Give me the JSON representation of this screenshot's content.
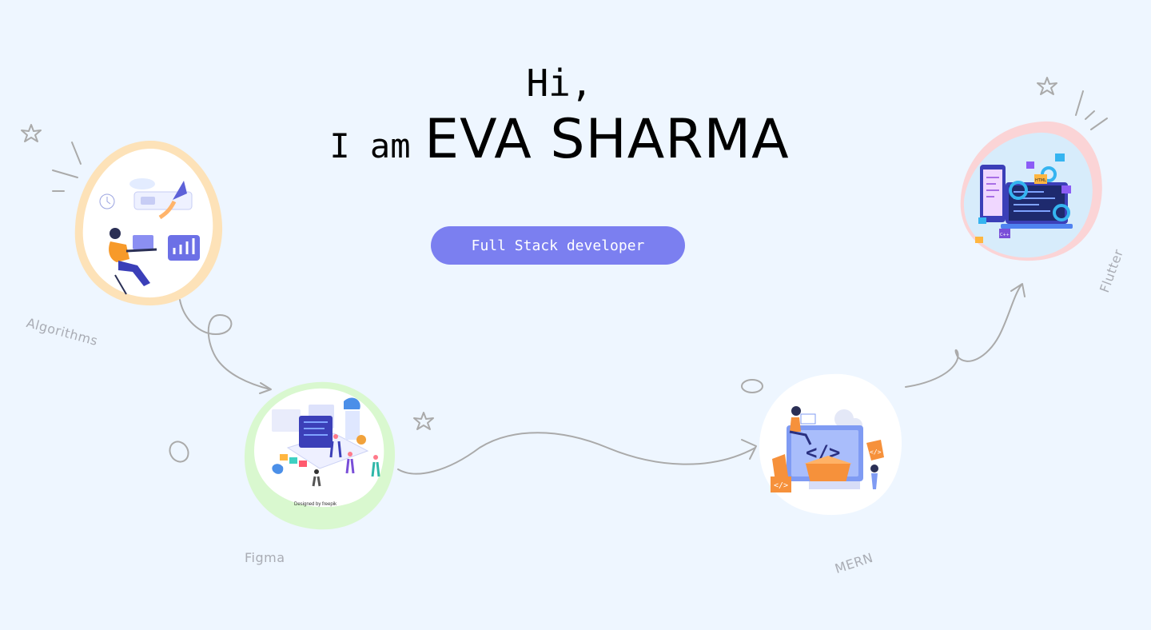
{
  "hero": {
    "greeting": "Hi,",
    "intro": "I am",
    "name": "EVA SHARMA",
    "role_button": "Full Stack developer"
  },
  "skills": [
    {
      "label": "Algorithms",
      "accent": "#fde2b8",
      "icon": "person-with-laptop-illustration"
    },
    {
      "label": "Figma",
      "accent": "#d9f8cf",
      "icon": "ui-design-workspace-illustration"
    },
    {
      "label": "MERN",
      "accent": "#ffffff",
      "icon": "code-box-illustration"
    },
    {
      "label": "Flutter",
      "accent": "#fbd4d6",
      "icon": "mobile-app-development-illustration"
    }
  ],
  "figma_credit": "Designed by freepik",
  "colors": {
    "background": "#eef6ff",
    "button": "#7b7ff0",
    "label": "#a9acb4",
    "doodle": "#aaaaaa"
  }
}
